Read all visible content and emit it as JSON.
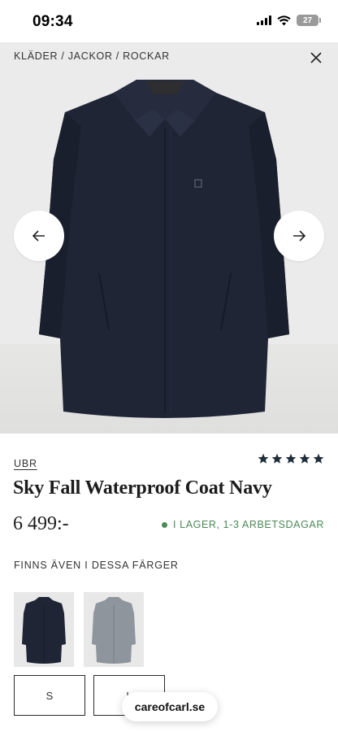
{
  "status_bar": {
    "time": "09:34",
    "battery": "27"
  },
  "breadcrumb": "KLÄDER / JACKOR / ROCKAR",
  "colors": {
    "accent_green": "#4a8a55",
    "coat_navy": "#1f2535",
    "rating_star": "#1f2f3a"
  },
  "product": {
    "brand": "UBR",
    "rating_stars": 5,
    "title": "Sky Fall Waterproof Coat Navy",
    "price": "6 499:-",
    "stock": "I LAGER, 1-3 ARBETSDAGAR"
  },
  "colors_section": {
    "label": "FINNS ÄVEN I DESSA FÄRGER",
    "options": [
      "navy",
      "grey"
    ]
  },
  "sizes": [
    {
      "label": "S"
    },
    {
      "label": "L"
    }
  ],
  "browser": {
    "url": "careofcarl.se"
  },
  "icons": {
    "close": "close-icon",
    "prev": "arrow-left-icon",
    "next": "arrow-right-icon",
    "star": "star-icon"
  }
}
